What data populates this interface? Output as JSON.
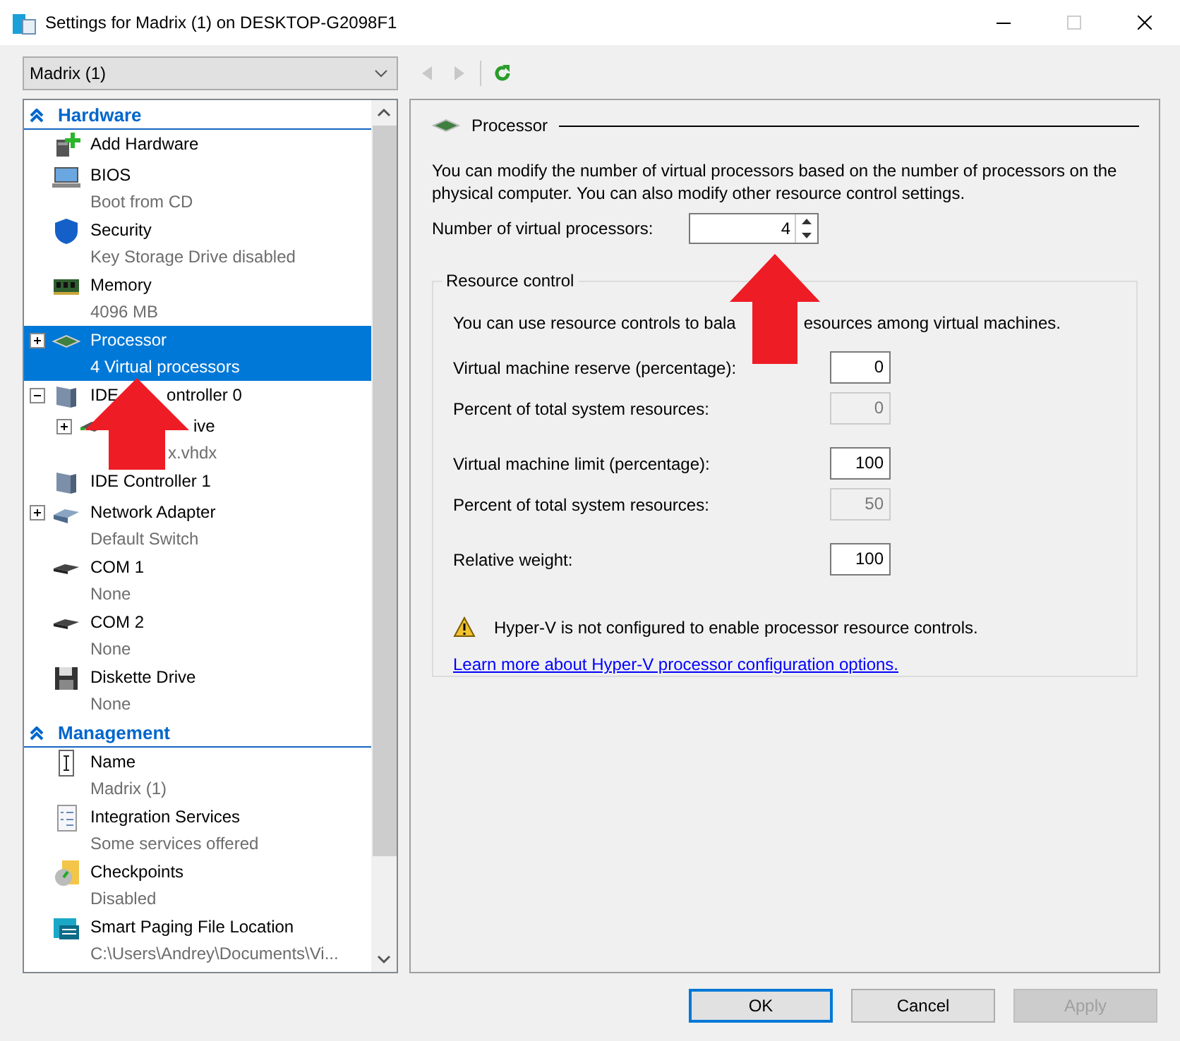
{
  "window": {
    "title": "Settings for Madrix (1) on DESKTOP-G2098F1"
  },
  "vm_selector": {
    "value": "Madrix (1)"
  },
  "tree": [
    {
      "kind": "header",
      "label": "Hardware",
      "expanded": true,
      "selected": false
    },
    {
      "kind": "add-hardware",
      "label": "Add Hardware",
      "selected": false
    },
    {
      "kind": "bios",
      "label": "BIOS",
      "detail": "Boot from CD",
      "selected": false
    },
    {
      "kind": "security",
      "label": "Security",
      "detail": "Key Storage Drive disabled",
      "selected": false
    },
    {
      "kind": "memory",
      "label": "Memory",
      "detail": "4096 MB",
      "selected": false
    },
    {
      "kind": "processor",
      "label": "Processor",
      "detail": "4 Virtual processors",
      "expanded": false,
      "selected": true
    },
    {
      "kind": "controller",
      "label": "IDE",
      "label_rest": "ontroller 0",
      "expanded": true,
      "selected": false,
      "children": [
        {
          "kind": "drive",
          "label": "ive",
          "detail": "x.vhdx",
          "expanded": false,
          "selected": false
        }
      ]
    },
    {
      "kind": "controller",
      "label": "IDE Controller 1",
      "selected": false
    },
    {
      "kind": "network",
      "label": "Network Adapter",
      "detail": "Default Switch",
      "expanded": false,
      "selected": false
    },
    {
      "kind": "com",
      "label": "COM 1",
      "detail": "None",
      "selected": false
    },
    {
      "kind": "com",
      "label": "COM 2",
      "detail": "None",
      "selected": false
    },
    {
      "kind": "diskette",
      "label": "Diskette Drive",
      "detail": "None",
      "selected": false
    },
    {
      "kind": "header",
      "label": "Management",
      "expanded": true,
      "selected": false
    },
    {
      "kind": "name",
      "label": "Name",
      "detail": "Madrix (1)",
      "selected": false
    },
    {
      "kind": "integration",
      "label": "Integration Services",
      "detail": "Some services offered",
      "selected": false
    },
    {
      "kind": "checkpoint",
      "label": "Checkpoints",
      "detail": "Disabled",
      "selected": false
    },
    {
      "kind": "paging",
      "label": "Smart Paging File Location",
      "detail": "C:\\Users\\Andrey\\Documents\\Vi...",
      "selected": false
    }
  ],
  "processor_panel": {
    "title": "Processor",
    "description": "You can modify the number of virtual processors based on the number of processors on the physical computer. You can also modify other resource control settings.",
    "count_label": "Number of virtual processors:",
    "count_value": "4"
  },
  "resource_control": {
    "title": "Resource control",
    "description": "You can use resource controls to bala",
    "description_rest": "esources among virtual machines.",
    "groups": [
      [
        {
          "label": "Virtual machine reserve (percentage):",
          "value": "0",
          "disabled": false
        },
        {
          "label": "Percent of total system resources:",
          "value": "0",
          "disabled": true
        }
      ],
      [
        {
          "label": "Virtual machine limit (percentage):",
          "value": "100",
          "disabled": false
        },
        {
          "label": "Percent of total system resources:",
          "value": "50",
          "disabled": true
        }
      ],
      [
        {
          "label": "Relative weight:",
          "value": "100",
          "disabled": false
        }
      ]
    ],
    "warning": "Hyper-V is not configured to enable processor resource controls.",
    "link": "Learn more about Hyper-V processor configuration options."
  },
  "buttons": [
    {
      "label": "OK",
      "default": true,
      "disabled": false
    },
    {
      "label": "Cancel",
      "default": false,
      "disabled": false
    },
    {
      "label": "Apply",
      "default": false,
      "disabled": true
    }
  ],
  "annotations": [
    {
      "kind": "arrow"
    },
    {
      "kind": "arrow"
    }
  ]
}
